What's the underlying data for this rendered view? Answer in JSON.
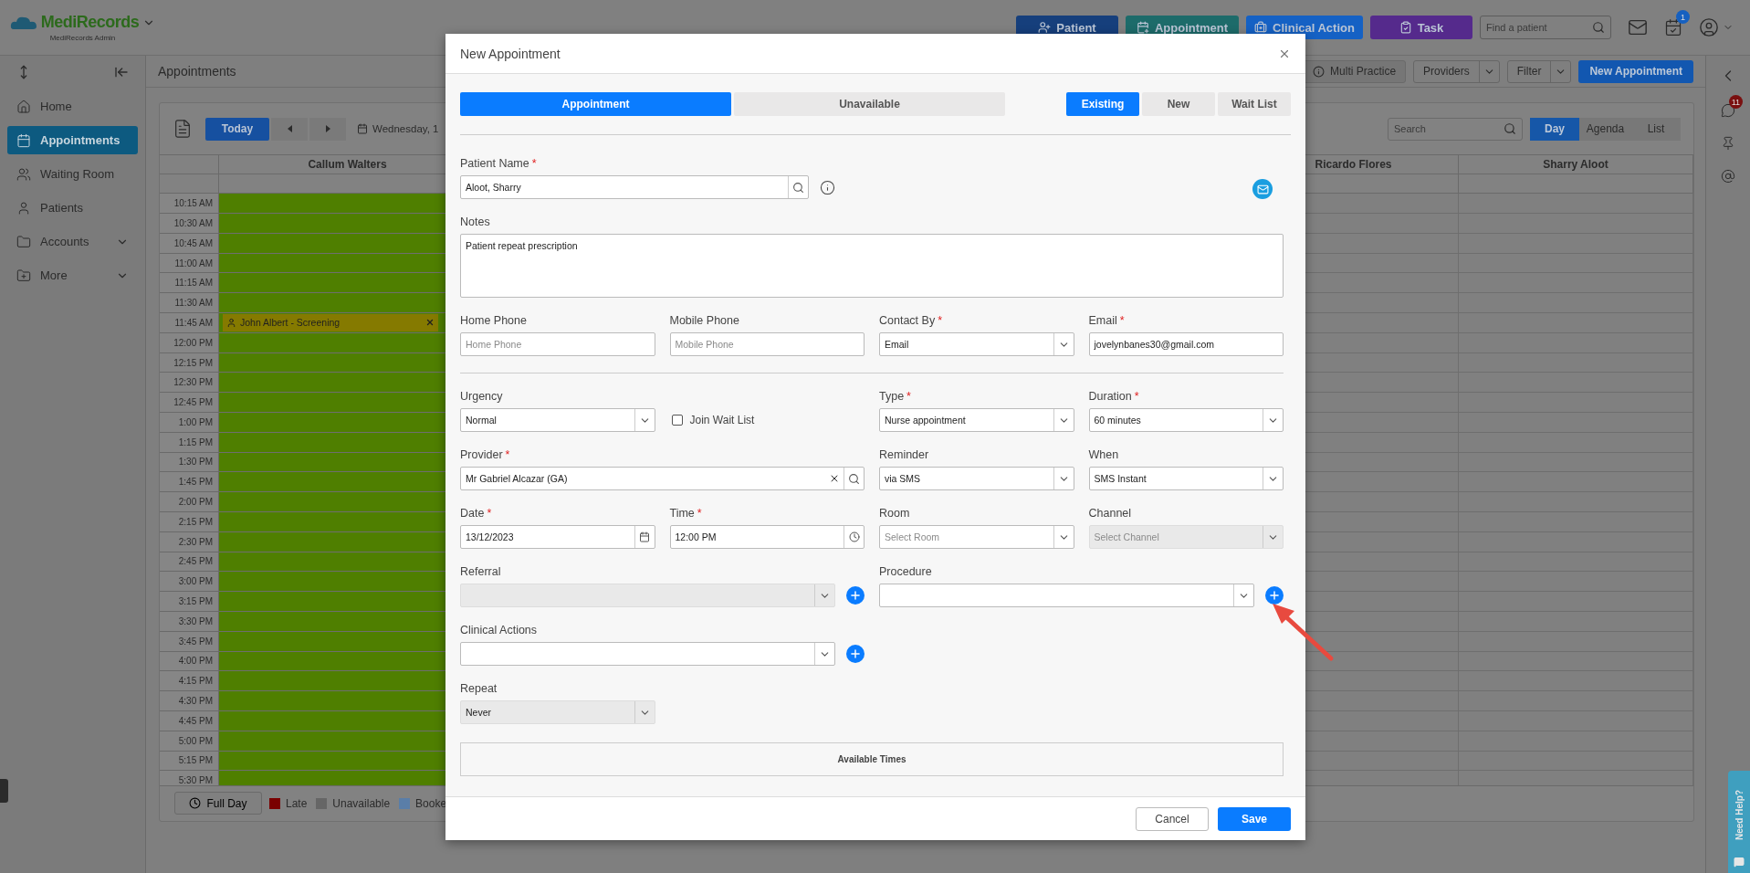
{
  "top_bar": {
    "logo": "MediRecords",
    "subtitle": "MediRecords Admin",
    "actions": [
      {
        "label": "Patient",
        "kind": "patient",
        "color": "#163f7c"
      },
      {
        "label": "Appointment",
        "kind": "appointment",
        "color": "#1d6b6a"
      },
      {
        "label": "Clinical Action",
        "kind": "clinical",
        "color": "#1561c4"
      },
      {
        "label": "Task",
        "kind": "task",
        "color": "#552a8c"
      }
    ],
    "search": {
      "placeholder": "Find a patient"
    },
    "tasks_badge": "1"
  },
  "sidebar": {
    "items": [
      {
        "label": "Home",
        "kind": "home",
        "selected": false,
        "expandable": false
      },
      {
        "label": "Appointments",
        "kind": "calendar",
        "selected": true,
        "expandable": false
      },
      {
        "label": "Waiting Room",
        "kind": "people",
        "selected": false,
        "expandable": false
      },
      {
        "label": "Patients",
        "kind": "person",
        "selected": false,
        "expandable": false
      },
      {
        "label": "Accounts",
        "kind": "folder",
        "selected": false,
        "expandable": true
      },
      {
        "label": "More",
        "kind": "folder_plus",
        "selected": false,
        "expandable": true
      }
    ]
  },
  "page": {
    "title": "Appointments",
    "multi_practice": "Multi Practice",
    "providers": "Providers",
    "filter": "Filter",
    "new_appointment": "New Appointment"
  },
  "calendar": {
    "today": "Today",
    "date": "Wednesday, 1",
    "search": {
      "placeholder": "Search"
    },
    "views": [
      {
        "label": "Day",
        "selected": true
      },
      {
        "label": "Agenda",
        "selected": false
      },
      {
        "label": "List",
        "selected": false
      }
    ],
    "columns": [
      {
        "name": "Callum Walters",
        "available": true
      },
      {
        "name": "Ricardo Flores",
        "available": false
      },
      {
        "name": "Sharry Aloot",
        "available": false
      }
    ],
    "rows": [
      {
        "time": "10:15 AM"
      },
      {
        "time": "10:30 AM"
      },
      {
        "time": "10:45 AM"
      },
      {
        "time": "11:00 AM"
      },
      {
        "time": "11:15 AM"
      },
      {
        "time": "11:30 AM"
      },
      {
        "time": "11:45 AM",
        "appointment": {
          "title": "John Albert - Screening"
        }
      },
      {
        "time": "12:00 PM"
      },
      {
        "time": "12:15 PM"
      },
      {
        "time": "12:30 PM"
      },
      {
        "time": "12:45 PM"
      },
      {
        "time": "1:00 PM"
      },
      {
        "time": "1:15 PM"
      },
      {
        "time": "1:30 PM"
      },
      {
        "time": "1:45 PM"
      },
      {
        "time": "2:00 PM"
      },
      {
        "time": "2:15 PM"
      },
      {
        "time": "2:30 PM"
      },
      {
        "time": "2:45 PM"
      },
      {
        "time": "3:00 PM"
      },
      {
        "time": "3:15 PM"
      },
      {
        "time": "3:30 PM"
      },
      {
        "time": "3:45 PM"
      },
      {
        "time": "4:00 PM"
      },
      {
        "time": "4:15 PM"
      },
      {
        "time": "4:30 PM"
      },
      {
        "time": "4:45 PM"
      },
      {
        "time": "5:00 PM"
      },
      {
        "time": "5:15 PM"
      },
      {
        "time": "5:30 PM"
      }
    ],
    "full_day": "Full Day",
    "legend": [
      {
        "label": "Late",
        "color": "#7a0000"
      },
      {
        "label": "Unavailable",
        "color": "#666666"
      },
      {
        "label": "Booke",
        "color": "#5a7ea8"
      }
    ]
  },
  "right_rail": {
    "messages_badge": "11",
    "help": "Need Help?"
  },
  "modal": {
    "title": "New Appointment",
    "mode_tabs": [
      {
        "label": "Appointment",
        "selected": true
      },
      {
        "label": "Unavailable",
        "selected": false
      }
    ],
    "patient_tabs": [
      {
        "label": "Existing",
        "selected": true
      },
      {
        "label": "New",
        "selected": false
      },
      {
        "label": "Wait List",
        "selected": false
      }
    ],
    "patient_name": {
      "label": "Patient Name",
      "required_mark": "*",
      "kind": "search",
      "value": "Aloot, Sharry"
    },
    "notes": {
      "label": "Notes",
      "value": "Patient repeat prescription"
    },
    "contact": [
      {
        "label": "Home Phone",
        "kind": "text",
        "placeholder": "Home Phone"
      },
      {
        "label": "Mobile Phone",
        "kind": "text",
        "placeholder": "Mobile Phone"
      },
      {
        "label": "Contact By",
        "required_mark": "*",
        "kind": "select",
        "value": "Email"
      },
      {
        "label": "Email",
        "required_mark": "*",
        "kind": "text",
        "value": "jovelynbanes30@gmail.com"
      }
    ],
    "urgency": {
      "label": "Urgency",
      "kind": "select",
      "value": "Normal"
    },
    "join_wait_list": {
      "label": "Join Wait List",
      "checked": false
    },
    "type": {
      "label": "Type",
      "required_mark": "*",
      "kind": "select",
      "value": "Nurse appointment"
    },
    "duration": {
      "label": "Duration",
      "required_mark": "*",
      "kind": "select",
      "value": "60 minutes"
    },
    "provider": {
      "label": "Provider",
      "required_mark": "*",
      "kind": "clearable_search",
      "value": "Mr Gabriel Alcazar (GA)"
    },
    "reminder": {
      "label": "Reminder",
      "kind": "select",
      "value": "via SMS"
    },
    "when": {
      "label": "When",
      "kind": "select",
      "value": "SMS Instant"
    },
    "date": {
      "label": "Date",
      "required_mark": "*",
      "kind": "date",
      "value": "13/12/2023"
    },
    "time": {
      "label": "Time",
      "required_mark": "*",
      "kind": "time",
      "value": "12:00 PM"
    },
    "room": {
      "label": "Room",
      "kind": "select",
      "placeholder": "Select Room"
    },
    "channel": {
      "label": "Channel",
      "kind": "select",
      "placeholder": "Select Channel",
      "disabled": true
    },
    "referral": {
      "label": "Referral",
      "kind": "select",
      "disabled": true
    },
    "procedure": {
      "label": "Procedure",
      "kind": "select",
      "disabled": false
    },
    "clinical_actions": {
      "label": "Clinical Actions",
      "kind": "select",
      "disabled": false
    },
    "repeat": {
      "label": "Repeat",
      "kind": "select",
      "value": "Never",
      "disabled": true
    },
    "available_times": "Available Times",
    "cancel": "Cancel",
    "save": "Save"
  }
}
